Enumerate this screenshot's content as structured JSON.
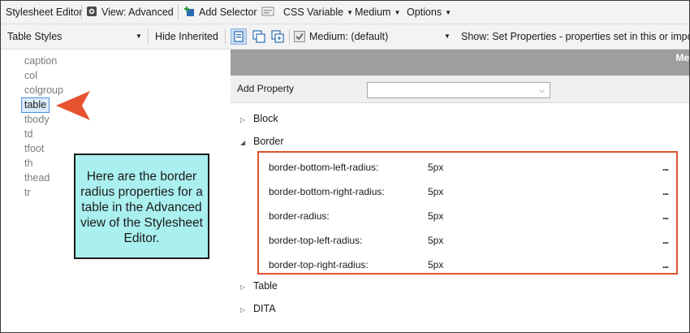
{
  "toolbar1": {
    "app_title": "Stylesheet Editor",
    "view_label": "View: Advanced",
    "add_selector_label": "Add Selector",
    "css_variable_label": "CSS Variable",
    "medium_label": "Medium",
    "options_label": "Options"
  },
  "toolbar2": {
    "styles_dropdown_value": "Table Styles",
    "hide_inherited_label": "Hide Inherited",
    "medium_dropdown_value": "Medium: (default)",
    "show_text": "Show: Set Properties - properties set in this or import"
  },
  "tree": {
    "items": [
      "caption",
      "col",
      "colgroup",
      "table",
      "tbody",
      "td",
      "tfoot",
      "th",
      "thead",
      "tr"
    ],
    "selected": "table"
  },
  "right_pane": {
    "header_title": "Me",
    "add_property_label": "Add Property",
    "add_property_value": "",
    "groups": {
      "block": "Block",
      "border": "Border",
      "table": "Table",
      "dita": "DITA"
    },
    "properties": [
      {
        "name": "border-bottom-left-radius:",
        "value": "5px",
        "more": "..."
      },
      {
        "name": "border-bottom-right-radius:",
        "value": "5px",
        "more": "..."
      },
      {
        "name": "border-radius:",
        "value": "5px",
        "more": "..."
      },
      {
        "name": "border-top-left-radius:",
        "value": "5px",
        "more": "..."
      },
      {
        "name": "border-top-right-radius:",
        "value": "5px",
        "more": "..."
      }
    ]
  },
  "callout": {
    "text": "Here are the border radius properties for a table in the Advanced view of the Stylesheet Editor."
  },
  "colors": {
    "callout_bg": "#aaf0ef",
    "highlight_border": "#e0522c",
    "arrow": "#e8532f",
    "header_bg": "#9e9e9e"
  }
}
